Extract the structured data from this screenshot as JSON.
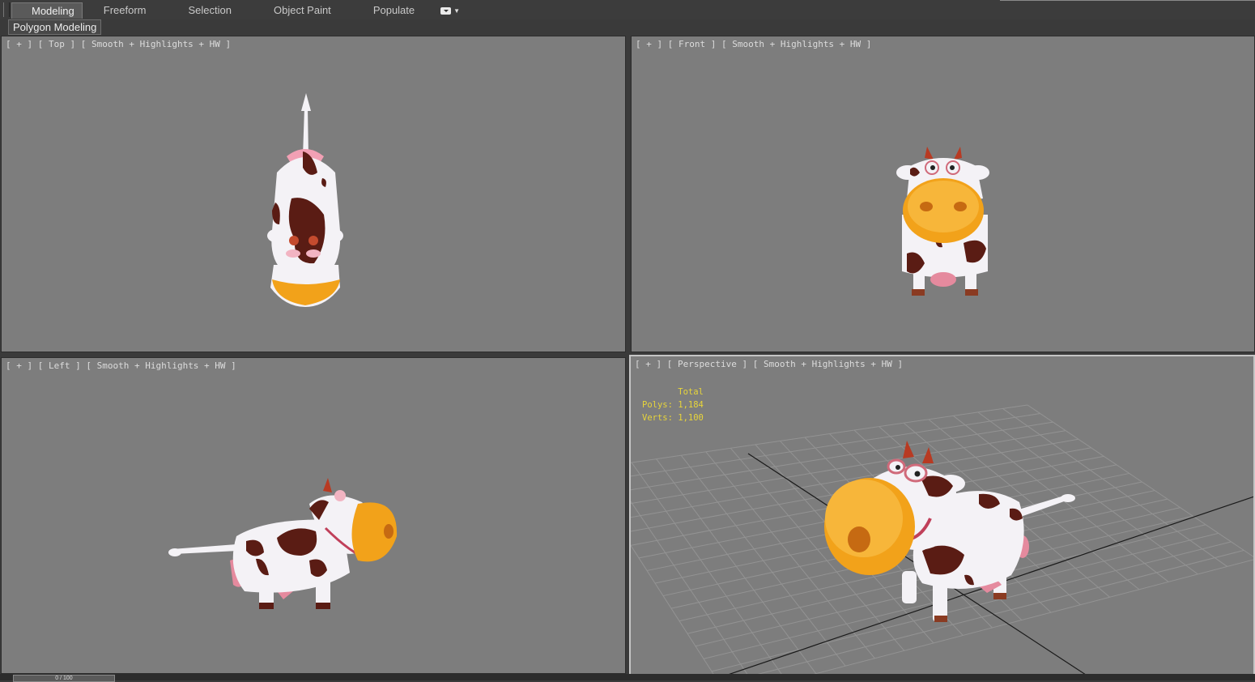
{
  "ribbon": {
    "tabs": [
      {
        "label": "Modeling",
        "active": true
      },
      {
        "label": "Freeform",
        "active": false
      },
      {
        "label": "Selection",
        "active": false
      },
      {
        "label": "Object Paint",
        "active": false
      },
      {
        "label": "Populate",
        "active": false
      }
    ],
    "extra_icon": "ribbon-options-icon"
  },
  "panel": {
    "label": "Polygon Modeling"
  },
  "viewports": {
    "top": {
      "plus": "[ + ]",
      "view": "[ Top ]",
      "shading": "[ Smooth + Highlights + HW ]"
    },
    "front": {
      "plus": "[ + ]",
      "view": "[ Front ]",
      "shading": "[ Smooth + Highlights + HW ]"
    },
    "left": {
      "plus": "[ + ]",
      "view": "[ Left ]",
      "shading": "[ Smooth + Highlights + HW ]"
    },
    "perspective": {
      "plus": "[ + ]",
      "view": "[ Perspective ]",
      "shading": "[ Smooth + Highlights + HW ]",
      "stats": {
        "header": "Total",
        "polys_label": "Polys:",
        "polys_value": "1,184",
        "verts_label": "Verts:",
        "verts_value": "1,100"
      }
    }
  },
  "timeline": {
    "frame": "0 / 100"
  },
  "colors": {
    "viewport_bg": "#7d7d7d",
    "stats_text": "#e8d53a",
    "muzzle": "#f2a21a",
    "cow_spot": "#5a1c14",
    "cow_body": "#f4f2f6"
  }
}
